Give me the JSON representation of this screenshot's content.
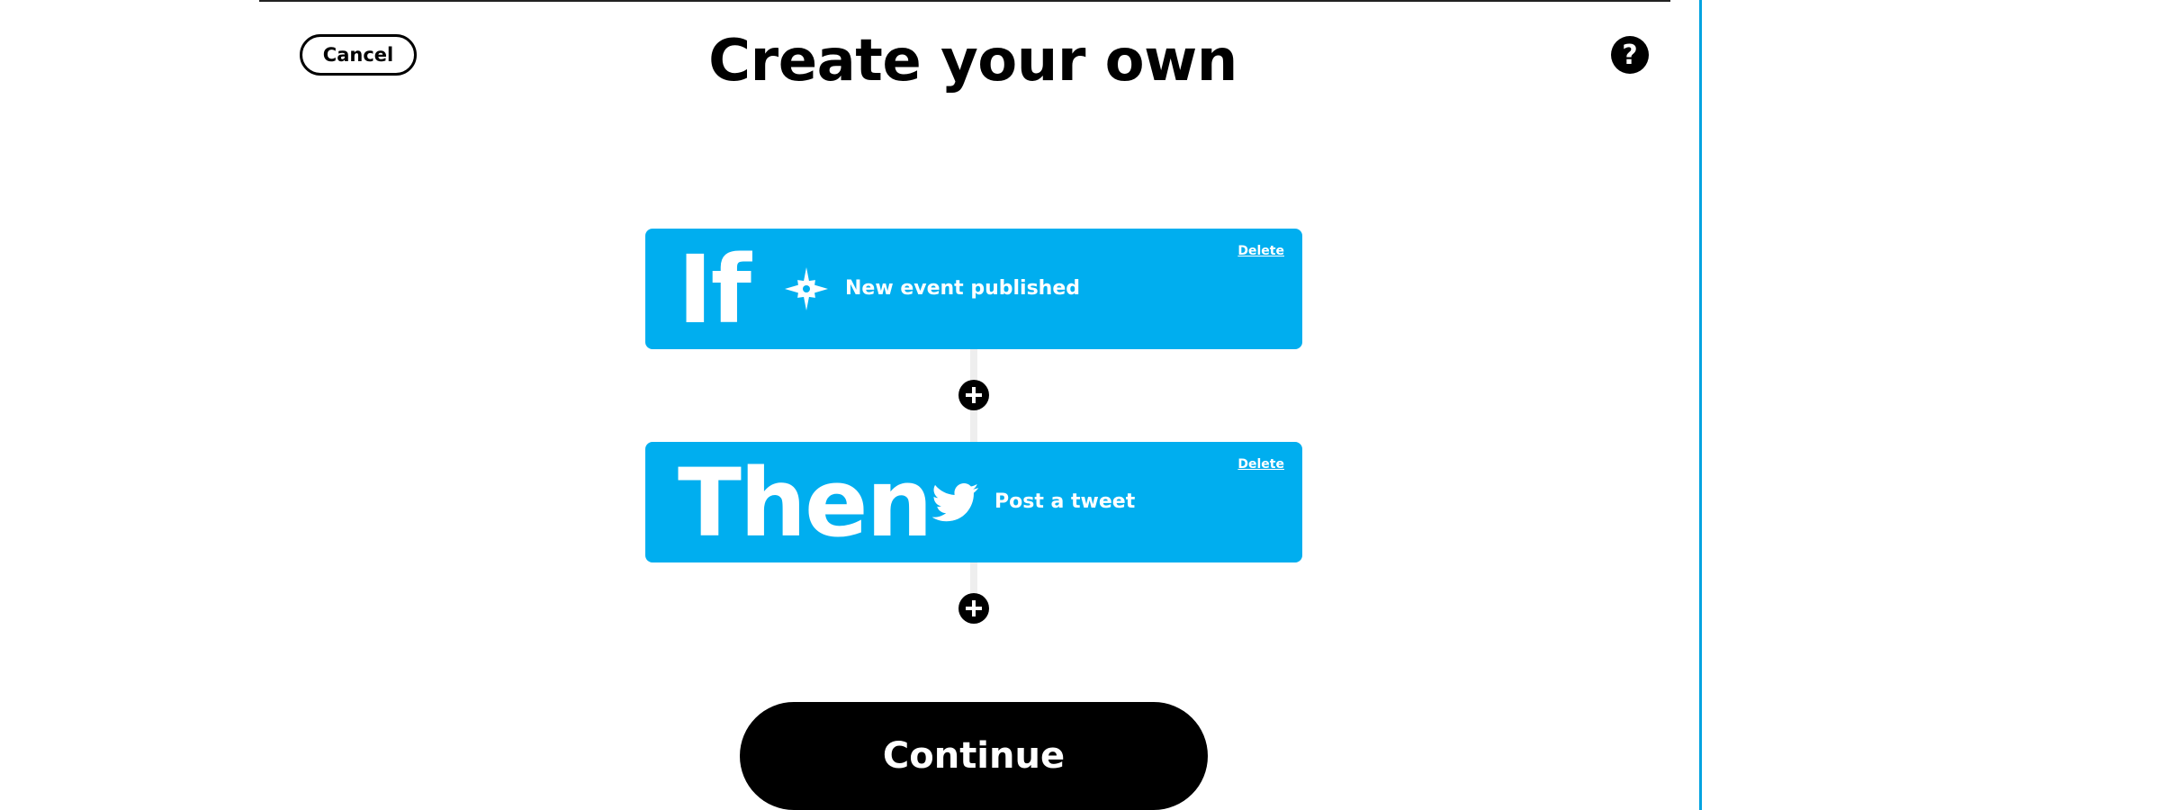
{
  "header": {
    "cancel_label": "Cancel",
    "title": "Create your own",
    "help_symbol": "?"
  },
  "applet": {
    "if_step": {
      "keyword": "If",
      "service_icon": "webhook-burst-icon",
      "label": "New event published",
      "delete_label": "Delete"
    },
    "then_step": {
      "keyword": "Then",
      "service_icon": "twitter-bird-icon",
      "label": "Post a tweet",
      "delete_label": "Delete"
    },
    "add_icon": "plus-circle-icon"
  },
  "footer": {
    "continue_label": "Continue"
  },
  "colors": {
    "accent": "#00aeef",
    "frame_border": "#00a3e0",
    "text": "#000000",
    "on_accent": "#ffffff"
  }
}
